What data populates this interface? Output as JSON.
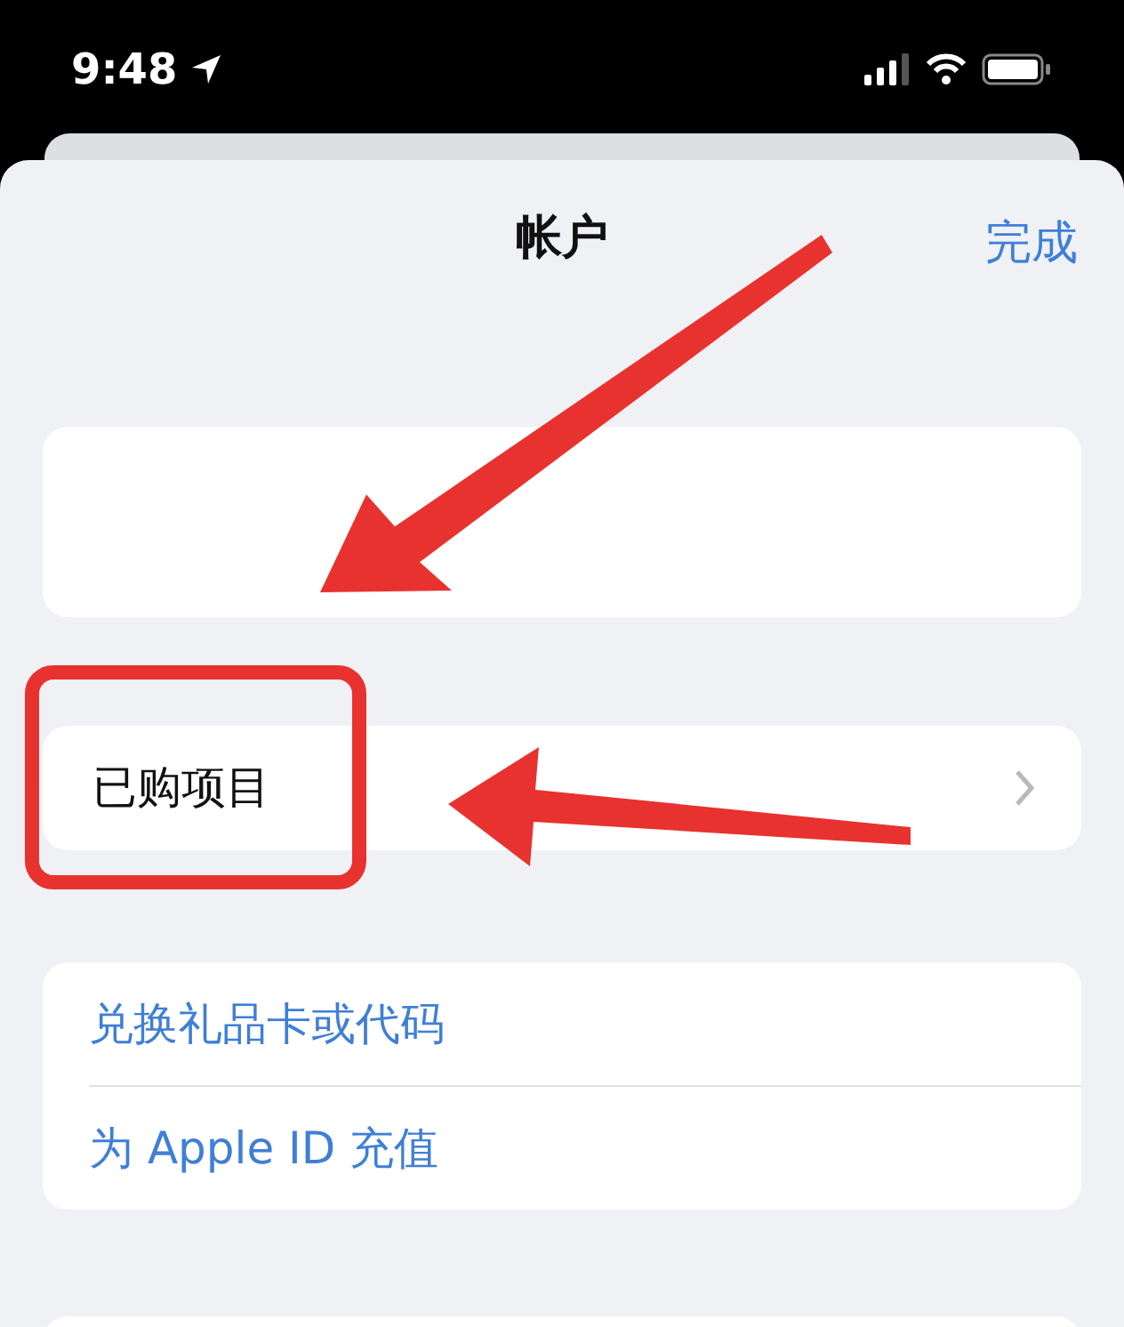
{
  "status_bar": {
    "time": "9:48"
  },
  "nav": {
    "title": "帐户",
    "done": "完成"
  },
  "purchased": {
    "label": "已购项目"
  },
  "actions": [
    {
      "label": "兑换礼品卡或代码"
    },
    {
      "label": "为 Apple ID 充值"
    }
  ]
}
